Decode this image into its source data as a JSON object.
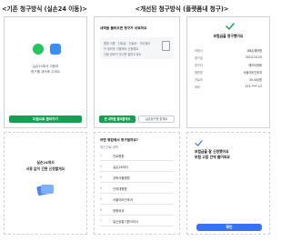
{
  "headers": {
    "left": "<기존 청구방식 (실손24 이동)>",
    "right": "<개선된 청구방식 (플랫폼내 청구)>"
  },
  "left_top": {
    "message_line1": "실손24에서 이용하",
    "message_line2": "청구를 계속해 주세요",
    "button": "다음으로 돌아가기"
  },
  "left_bottom": {
    "message_line1": "실손24에서",
    "message_line2": "서류 없이 간편 신청할게요"
  },
  "mid_top": {
    "title": "내역을 불러오면 청구가 쉬워져요",
    "card_line1": "병원 이름 · 진료일 · 진료비 · 기타정보",
    "card_line2": "이 정보를 이용해서 신청해요",
    "card_line3": "다음 정보가 아니면 알려주세요",
    "btn_primary": "본 내역을 불러올게요",
    "btn_secondary": "실손청구를 할게요"
  },
  "mid_bottom": {
    "title": "어떤 병원에서 청구할까요?",
    "subtitle": "최근 진료 내역",
    "items": [
      {
        "num": "1",
        "label": "진료병원"
      },
      {
        "num": "2",
        "label": "실손24에서"
      },
      {
        "num": "3",
        "label": "강북서울병원"
      },
      {
        "num": "4",
        "label": "인하대병원"
      },
      {
        "num": "5",
        "label": "서울이비인후과"
      },
      {
        "num": "6",
        "label": "정형외과"
      },
      {
        "num": "7",
        "label": "일산공통기원크리닉"
      }
    ]
  },
  "right_top": {
    "check_color": "#12a150",
    "title": "보험금을 청구했어요",
    "fields": [
      {
        "label": "보험사",
        "value": "DB손해보험"
      },
      {
        "label": "청구일",
        "value": "2024.10.25"
      },
      {
        "label": "청구자",
        "value": "에이티한화"
      },
      {
        "label": "병원명",
        "value": "서울이비인후과"
      },
      {
        "label": "진료비",
        "value": "30,000원"
      },
      {
        "label": "계좌",
        "value": "123-****-12"
      }
    ]
  },
  "right_bottom": {
    "check_color": "#3a6ff7",
    "title_line1": "보험금을 잘 신청했어요",
    "title_line2": "보험 고맙 안에 들어와요",
    "button": "확인"
  }
}
